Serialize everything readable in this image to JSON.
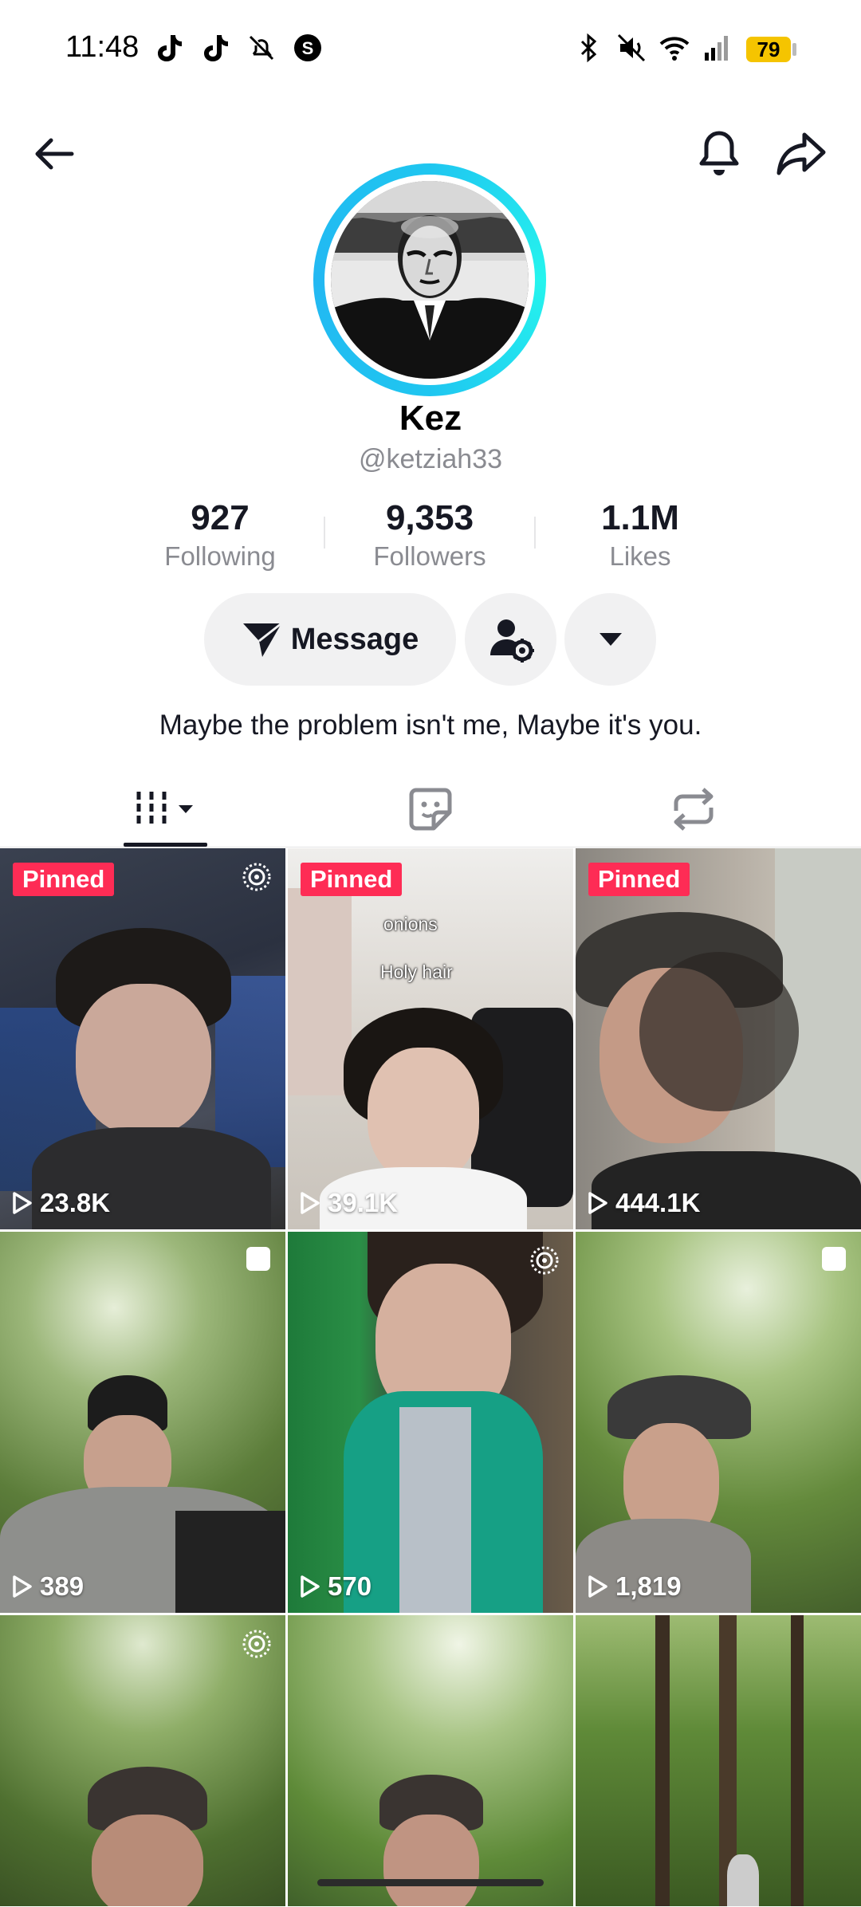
{
  "status_bar": {
    "time": "11:48",
    "battery": "79",
    "left_icons": [
      "tiktok-icon",
      "tiktok-icon",
      "notifications-off-icon",
      "threads-icon"
    ],
    "right_icons": [
      "bluetooth-icon",
      "mute-icon",
      "wifi-icon",
      "signal-icon",
      "battery-icon"
    ]
  },
  "header": {
    "back_icon": "back-arrow-icon",
    "bell_icon": "bell-icon",
    "share_icon": "share-icon"
  },
  "profile": {
    "display_name": "Kez",
    "username": "@ketziah33",
    "bio": "Maybe the problem isn't me, Maybe it's you.",
    "ring_color": "#25f4ee"
  },
  "stats": [
    {
      "value": "927",
      "label": "Following"
    },
    {
      "value": "9,353",
      "label": "Followers"
    },
    {
      "value": "1.1M",
      "label": "Likes"
    }
  ],
  "actions": {
    "message_label": "Message",
    "add_friend_icon": "person-settings-icon",
    "more_icon": "caret-down-icon"
  },
  "tabs": [
    {
      "icon": "videos-grid-icon",
      "active": true
    },
    {
      "icon": "sticker-icon",
      "active": false
    },
    {
      "icon": "repost-icon",
      "active": false
    }
  ],
  "videos": [
    {
      "pinned_label": "Pinned",
      "views": "23.8K"
    },
    {
      "pinned_label": "Pinned",
      "views": "39.1K",
      "caption_lines": [
        "onions",
        "Holy hair"
      ]
    },
    {
      "pinned_label": "Pinned",
      "views": "444.1K"
    },
    {
      "views": "389"
    },
    {
      "views": "570"
    },
    {
      "views": "1,819"
    },
    {},
    {},
    {}
  ],
  "colors": {
    "pinned": "#fe2c55",
    "text_primary": "#161823",
    "text_secondary": "#8a8b91",
    "button_bg": "#f1f1f2"
  }
}
